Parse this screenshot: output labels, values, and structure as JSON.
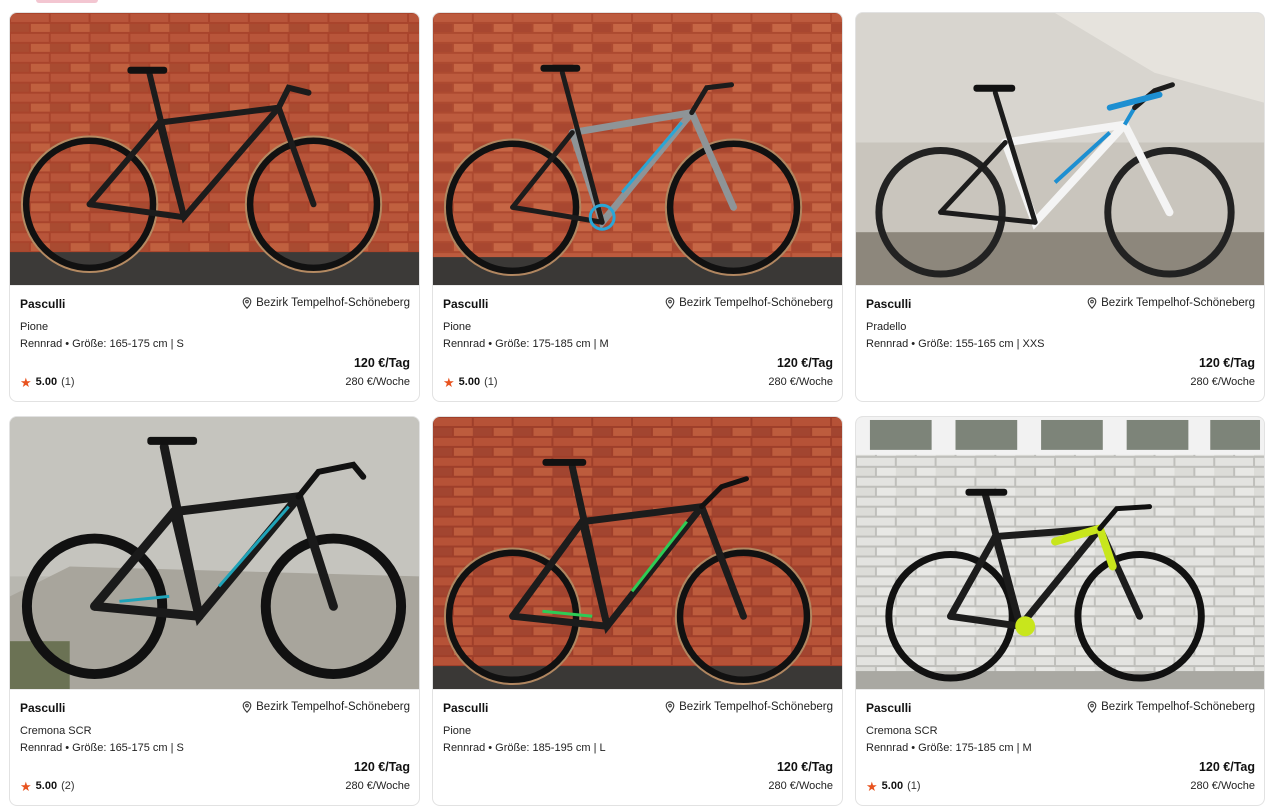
{
  "listings": [
    {
      "brand": "Pasculli",
      "location": "Bezirk Tempelhof-Schöneberg",
      "model": "Pione",
      "spec": "Rennrad • Größe: 165-175 cm | S",
      "price_day": "120 €/Tag",
      "price_week": "280 €/Woche",
      "rating": "5.00",
      "rating_count": "(1)",
      "image": "black gravel bike against red brick wall"
    },
    {
      "brand": "Pasculli",
      "location": "Bezirk Tempelhof-Schöneberg",
      "model": "Pione",
      "spec": "Rennrad • Größe: 175-185 cm | M",
      "price_day": "120 €/Tag",
      "price_week": "280 €/Woche",
      "rating": "5.00",
      "rating_count": "(1)",
      "image": "grey and blue gravel bike against red brick wall"
    },
    {
      "brand": "Pasculli",
      "location": "Bezirk Tempelhof-Schöneberg",
      "model": "Pradello",
      "spec": "Rennrad • Größe: 155-165 cm | XXS",
      "price_day": "120 €/Tag",
      "price_week": "280 €/Woche",
      "rating": "",
      "rating_count": "",
      "image": "white and blue road bike against concrete wall"
    },
    {
      "brand": "Pasculli",
      "location": "Bezirk Tempelhof-Schöneberg",
      "model": "Cremona SCR",
      "spec": "Rennrad • Größe: 165-175 cm | S",
      "price_day": "120 €/Tag",
      "price_week": "280 €/Woche",
      "rating": "5.00",
      "rating_count": "(2)",
      "image": "black road bike with teal accents against plaster wall"
    },
    {
      "brand": "Pasculli",
      "location": "Bezirk Tempelhof-Schöneberg",
      "model": "Pione",
      "spec": "Rennrad • Größe: 185-195 cm | L",
      "price_day": "120 €/Tag",
      "price_week": "280 €/Woche",
      "rating": "",
      "rating_count": "",
      "image": "black and green gravel bike against red brick wall"
    },
    {
      "brand": "Pasculli",
      "location": "Bezirk Tempelhof-Schöneberg",
      "model": "Cremona SCR",
      "spec": "Rennrad • Größe: 175-185 cm | M",
      "price_day": "120 €/Tag",
      "price_week": "280 €/Woche",
      "rating": "5.00",
      "rating_count": "(1)",
      "image": "black and neon yellow road bike against white brick wall"
    }
  ],
  "icons": {
    "location": "map-pin-icon",
    "rating": "star-icon"
  },
  "colors": {
    "star": "#e8531f",
    "border": "#e2e2e2",
    "top_pill": "#f3c6d1"
  }
}
